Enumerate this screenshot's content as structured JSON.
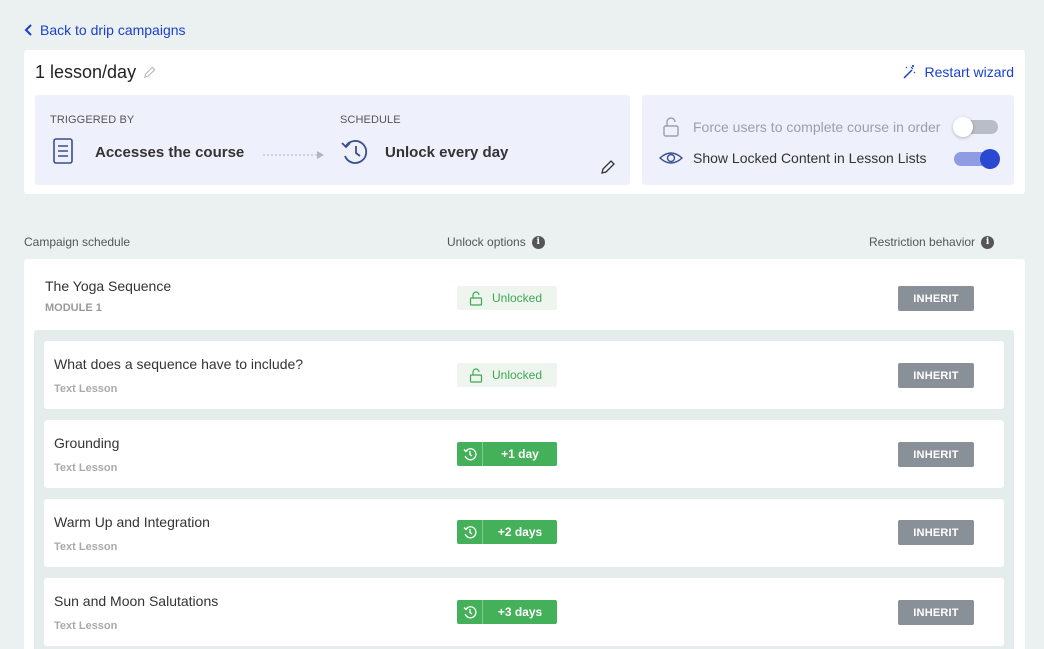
{
  "nav": {
    "back_label": "Back to drip campaigns"
  },
  "header": {
    "title": "1 lesson/day",
    "restart_label": "Restart wizard",
    "triggered_by_label": "TRIGGERED BY",
    "triggered_by_value": "Accesses the course",
    "schedule_label": "SCHEDULE",
    "schedule_value": "Unlock every day"
  },
  "options": {
    "force_order_label": "Force users to complete course in order",
    "force_order_on": false,
    "show_locked_label": "Show Locked Content in Lesson Lists",
    "show_locked_on": true
  },
  "columns": {
    "schedule": "Campaign schedule",
    "unlock": "Unlock options",
    "restriction": "Restriction behavior"
  },
  "module": {
    "title": "The Yoga Sequence",
    "subtitle": "MODULE 1",
    "unlock_label": "Unlocked",
    "restriction_label": "INHERIT"
  },
  "lessons": [
    {
      "title": "What does a sequence have to include?",
      "type": "Text Lesson",
      "unlock": "Unlocked",
      "restriction": "INHERIT"
    },
    {
      "title": "Grounding",
      "type": "Text Lesson",
      "unlock": "+1 day",
      "restriction": "INHERIT"
    },
    {
      "title": "Warm Up and Integration",
      "type": "Text Lesson",
      "unlock": "+2 days",
      "restriction": "INHERIT"
    },
    {
      "title": "Sun and Moon Salutations",
      "type": "Text Lesson",
      "unlock": "+3 days",
      "restriction": "INHERIT"
    }
  ],
  "colors": {
    "accent_blue": "#1a3fcc",
    "unlock_green": "#44b05a",
    "inherit_gray": "#8a9098"
  }
}
